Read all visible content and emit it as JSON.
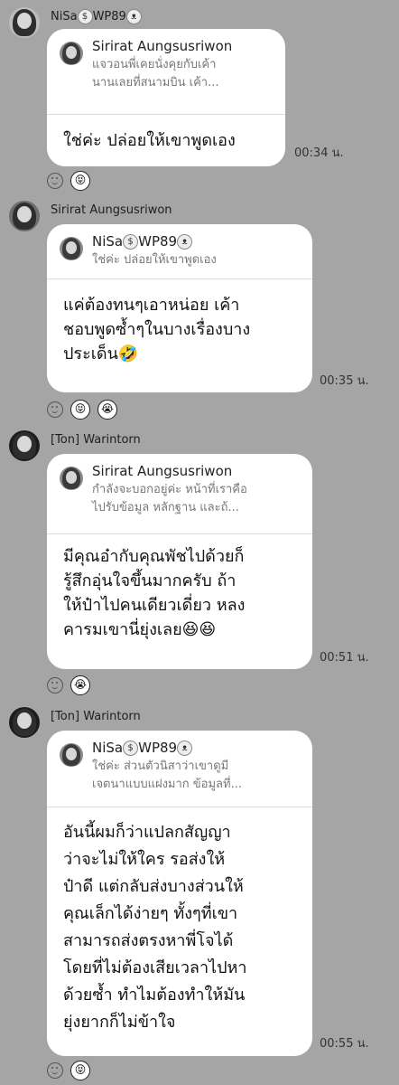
{
  "messages": [
    {
      "sender": "NiSa",
      "sender_suffix": "WP89",
      "quote_name": "Sirirat Aungsusriwon",
      "quote_lines": [
        "แจวอนพี่เคยนั่งคุยกับเค้า",
        "นานเลยที่สนามบิน  เค้า..."
      ],
      "text_lines": [
        "ใช่ค่ะ ปล่อยให้เขาพูดเอง"
      ],
      "time": "00:34 น.",
      "reactions": [
        "😝"
      ]
    },
    {
      "sender": "Sirirat Aungsusriwon",
      "quote_name": "NiSa",
      "quote_name_suffix": "WP89",
      "quote_lines": [
        "ใช่ค่ะ ปล่อยให้เขาพูดเอง"
      ],
      "text_lines": [
        "แค่ต้องทนๆเอาหน่อย เค้า",
        "ชอบพูดซ้ำๆในบางเรื่องบาง",
        "ประเด็น🤣"
      ],
      "time": "00:35 น.",
      "reactions": [
        "😝",
        "😭"
      ]
    },
    {
      "sender": "[Ton] Warintorn",
      "quote_name": "Sirirat Aungsusriwon",
      "quote_lines": [
        "กำลังจะบอกอยู่ค่ะ หน้าที่เราคือ",
        "ไปรับข้อมูล หลักฐาน และถ้..."
      ],
      "text_lines": [
        "มีคุณอ๋ากับคุณพัชไปด้วยก็",
        "รู้สึกอุ่นใจขึ้นมากครับ ถ้า",
        "ให้ป๋าไปคนเดียวเดี่ยว หลง",
        "คารมเขานี่ยุ่งเลย😆😆"
      ],
      "time": "00:51 น.",
      "reactions": [
        "😭"
      ]
    },
    {
      "sender": "[Ton] Warintorn",
      "quote_name": "NiSa",
      "quote_name_suffix": "WP89",
      "quote_lines": [
        "ใช่ค่ะ ส่วนตัวนิสาว่าเขาดูมี",
        "เจตนาแบบแฝงมาก ข้อมูลที่..."
      ],
      "text_lines": [
        "อันนี้ผมก็ว่าแปลกสัญญา",
        "ว่าจะไม่ให้ใคร รอส่งให้",
        "ป๋าดี แต่กลับส่งบางส่วนให้",
        "คุณเล็กได้ง่ายๆ ทั้งๆที่เขา",
        "สามารถส่งตรงหาพี่โจได้",
        "โดยที่ไม่ต้องเสียเวลาไปหา",
        "ด้วยซ้ำ ทำไมต้องทำให้มัน",
        "ยุ่งยากก็ไม่ข้าใจ"
      ],
      "time": "00:55 น.",
      "reactions": [
        "😝"
      ]
    }
  ]
}
